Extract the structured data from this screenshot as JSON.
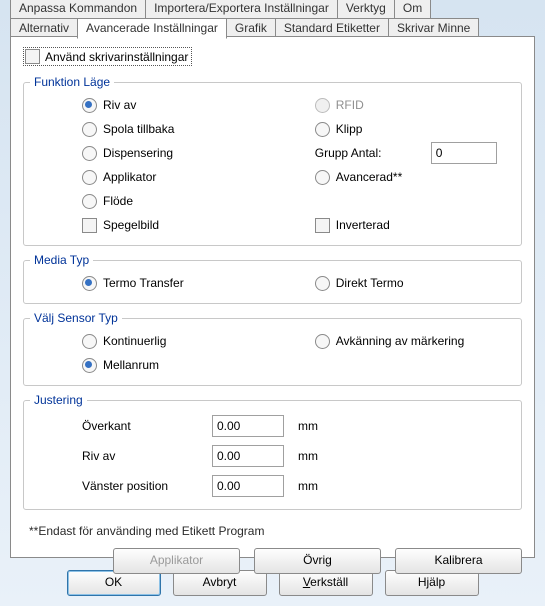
{
  "tabs_row1": {
    "t0": "Anpassa Kommandon",
    "t1": "Importera/Exportera Inställningar",
    "t2": "Verktyg",
    "t3": "Om"
  },
  "tabs_row2": {
    "t0": "Alternativ",
    "t1": "Avancerade Inställningar",
    "t2": "Grafik",
    "t3": "Standard Etiketter",
    "t4": "Skrivar Minne"
  },
  "use_printer_settings": "Använd skrivarinställningar",
  "groups": {
    "funktion": "Funktion Läge",
    "media": "Media Typ",
    "sensor": "Välj Sensor Typ",
    "justering": "Justering"
  },
  "funktion_left": {
    "riv": "Riv av",
    "spola": "Spola tillbaka",
    "disp": "Dispensering",
    "app": "Applikator",
    "flode": "Flöde",
    "spegel": "Spegelbild"
  },
  "funktion_right": {
    "rfid": "RFID",
    "klipp": "Klipp",
    "grupp_antal": "Grupp Antal:",
    "grupp_val": "0",
    "avanc": "Avancerad**",
    "inverterad": "Inverterad"
  },
  "media": {
    "termo_transfer": "Termo Transfer",
    "direkt_termo": "Direkt Termo"
  },
  "sensor": {
    "kontinuerlig": "Kontinuerlig",
    "mellanrum": "Mellanrum",
    "avkanning": "Avkänning av märkering"
  },
  "justering": {
    "overkant": "Överkant",
    "riv": "Riv av",
    "vanster": "Vänster position",
    "v_over": "0.00",
    "v_riv": "0.00",
    "v_van": "0.00",
    "unit": "mm"
  },
  "note": "**Endast för använding med Etikett Program",
  "frame_buttons": {
    "applikator": "Applikator",
    "ovrig": "Övrig",
    "kalibrera": "Kalibrera"
  },
  "dlg_buttons": {
    "ok": "OK",
    "avbryt": "Avbryt",
    "verkstall_pre": "V",
    "verkstall_post": "erkställ",
    "hjalp": "Hjälp"
  }
}
